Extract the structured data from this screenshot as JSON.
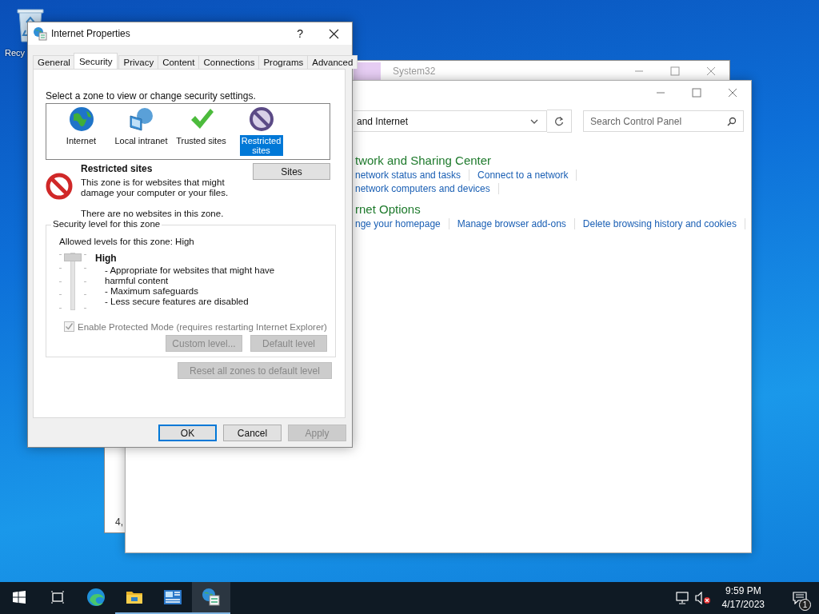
{
  "desktop_icons": [
    {
      "label": "Recy"
    }
  ],
  "explorer_window": {
    "title": "System32",
    "status_text": "4,"
  },
  "control_panel": {
    "address": "and Internet",
    "search": {
      "placeholder": "Search Control Panel"
    },
    "sections": [
      {
        "heading": "twork and Sharing Center",
        "link_rows": [
          [
            "network status and tasks",
            "Connect to a network"
          ],
          [
            "network computers and devices"
          ]
        ]
      },
      {
        "heading": "rnet Options",
        "link_rows": [
          [
            "nge your homepage",
            "Manage browser add-ons",
            "Delete browsing history and cookies"
          ]
        ]
      }
    ]
  },
  "dialog": {
    "title": "Internet Properties",
    "help": "?",
    "tabs": [
      {
        "label": "General",
        "selected": false
      },
      {
        "label": "Security",
        "selected": true
      },
      {
        "label": "Privacy",
        "selected": false
      },
      {
        "label": "Content",
        "selected": false
      },
      {
        "label": "Connections",
        "selected": false
      },
      {
        "label": "Programs",
        "selected": false
      },
      {
        "label": "Advanced",
        "selected": false
      }
    ],
    "zone_prompt": "Select a zone to view or change security settings.",
    "zones": [
      {
        "kind": "globe",
        "label": "Internet",
        "selected": false
      },
      {
        "kind": "intranet",
        "label": "Local intranet",
        "selected": false
      },
      {
        "kind": "check",
        "label": "Trusted sites",
        "selected": false
      },
      {
        "kind": "restricted",
        "label": "Restricted sites",
        "selected": true
      }
    ],
    "zone_name": "Restricted sites",
    "zone_description": "This zone is for websites that might damage your computer or your files.",
    "zone_note": "There are no websites in this zone.",
    "sites_button": {
      "label": "Sites",
      "disabled": false
    },
    "security": {
      "legend": "Security level for this zone",
      "allowed": "Allowed levels for this zone: High",
      "level": 1,
      "level_name": "High",
      "points": [
        "- Appropriate for websites that might have harmful content",
        "- Maximum safeguards",
        "- Less secure features are disabled"
      ]
    },
    "protected_mode": {
      "label": "Enable Protected Mode (requires restarting Internet Explorer)",
      "checked": true,
      "disabled": true
    },
    "level_buttons": [
      {
        "label": "Custom level...",
        "disabled": true
      },
      {
        "label": "Default level",
        "disabled": true
      }
    ],
    "reset_button": {
      "label": "Reset all zones to default level",
      "disabled": true
    },
    "buttons": [
      {
        "label": "OK",
        "default": true,
        "disabled": false
      },
      {
        "label": "Cancel",
        "default": false,
        "disabled": false
      },
      {
        "label": "Apply",
        "default": false,
        "disabled": true
      }
    ]
  },
  "taskbar": {
    "apps": [
      {
        "kind": "taskview",
        "running": false,
        "active": false
      },
      {
        "kind": "edge",
        "running": false,
        "active": false
      },
      {
        "kind": "folder",
        "running": true,
        "active": false
      },
      {
        "kind": "controlpanel",
        "running": true,
        "active": false
      },
      {
        "kind": "inetprops",
        "running": true,
        "active": true
      }
    ],
    "clock": {
      "time": "9:59 PM",
      "date": "4/17/2023"
    },
    "notification_count": "1"
  }
}
